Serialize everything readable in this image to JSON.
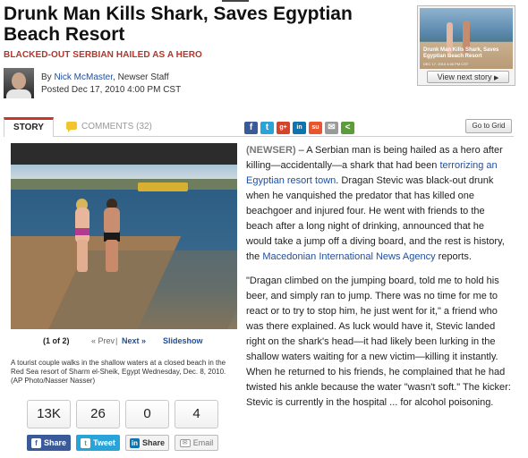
{
  "headline": "Drunk Man Kills Shark, Saves Egyptian Beach Resort",
  "subheadline": "BLACKED-OUT SERBIAN HAILED AS A HERO",
  "byline": {
    "prefix": "By",
    "author": "Nick McMaster",
    "role": ", Newser Staff",
    "posted": "Posted Dec 17, 2010 4:00 PM CST"
  },
  "next_story": {
    "thumb_title": "Drunk Man Kills Shark, Saves Egyptian Beach Resort",
    "thumb_date": "DEC 17, 2010 4:00 PM CST",
    "button_label": "View next story",
    "button_icon": "triangle-right-icon"
  },
  "tabs": {
    "story": "STORY",
    "comments": "COMMENTS (32)"
  },
  "share_icons": [
    {
      "name": "facebook-icon",
      "glyph": "f",
      "color": "#3b5a9a"
    },
    {
      "name": "twitter-icon",
      "glyph": "t",
      "color": "#2aa3d8"
    },
    {
      "name": "google-plus-icon",
      "glyph": "g+",
      "color": "#d5432d"
    },
    {
      "name": "linkedin-icon",
      "glyph": "in",
      "color": "#0c75b0"
    },
    {
      "name": "stumbleupon-icon",
      "glyph": "su",
      "color": "#e8552e"
    },
    {
      "name": "email-icon",
      "glyph": "✉",
      "color": "#9a9a9a"
    },
    {
      "name": "share-icon",
      "glyph": "<",
      "color": "#5c9d3a"
    }
  ],
  "grid_button": "Go to Grid",
  "photo": {
    "counter": "(1 of 2)",
    "prev": "« Prev",
    "separator": "|",
    "next": "Next »",
    "slideshow": "Slideshow",
    "caption": "A tourist couple walks in the shallow waters at a closed beach in the Red Sea resort of Sharm el-Sheik, Egypt Wednesday, Dec. 8, 2010.   (AP Photo/Nasser Nasser)"
  },
  "social_counts": [
    "13K",
    "26",
    "0",
    "4"
  ],
  "social_buttons": [
    {
      "label": "Share",
      "icon_glyph": "f"
    },
    {
      "label": "Tweet",
      "icon_glyph": "t"
    },
    {
      "label": "Share",
      "icon_glyph": "in"
    },
    {
      "label": "Email",
      "icon_glyph": "✉"
    }
  ],
  "article": {
    "p1": {
      "lead": "(NEWSER)",
      "text_a": " – A Serbian man is being hailed as a hero after killing—accidentally—a shark that had been ",
      "link_a": "terrorizing an Egyptian resort town",
      "text_b": ". Dragan Stevic was black-out drunk when he vanquished the predator that has killed one beachgoer and injured four. He went with friends to the beach after a long night of drinking, announced that he would take a jump off a diving board, and the rest is history, the ",
      "link_b": "Macedonian International News Agency",
      "text_c": " reports."
    },
    "p2": "\"Dragan climbed on the jumping board, told me to hold his beer, and simply ran to jump. There was no time for me to react or to try to stop him, he just went for it,\" a friend who was there explained. As luck would have it, Stevic landed right on the shark's head—it had likely been lurking in the shallow waters waiting for a new victim—killing it instantly. When he returned to his friends, he complained that he had twisted his ankle because the water \"wasn't soft.\" The kicker: Stevic is currently in the hospital ... for alcohol poisoning."
  }
}
